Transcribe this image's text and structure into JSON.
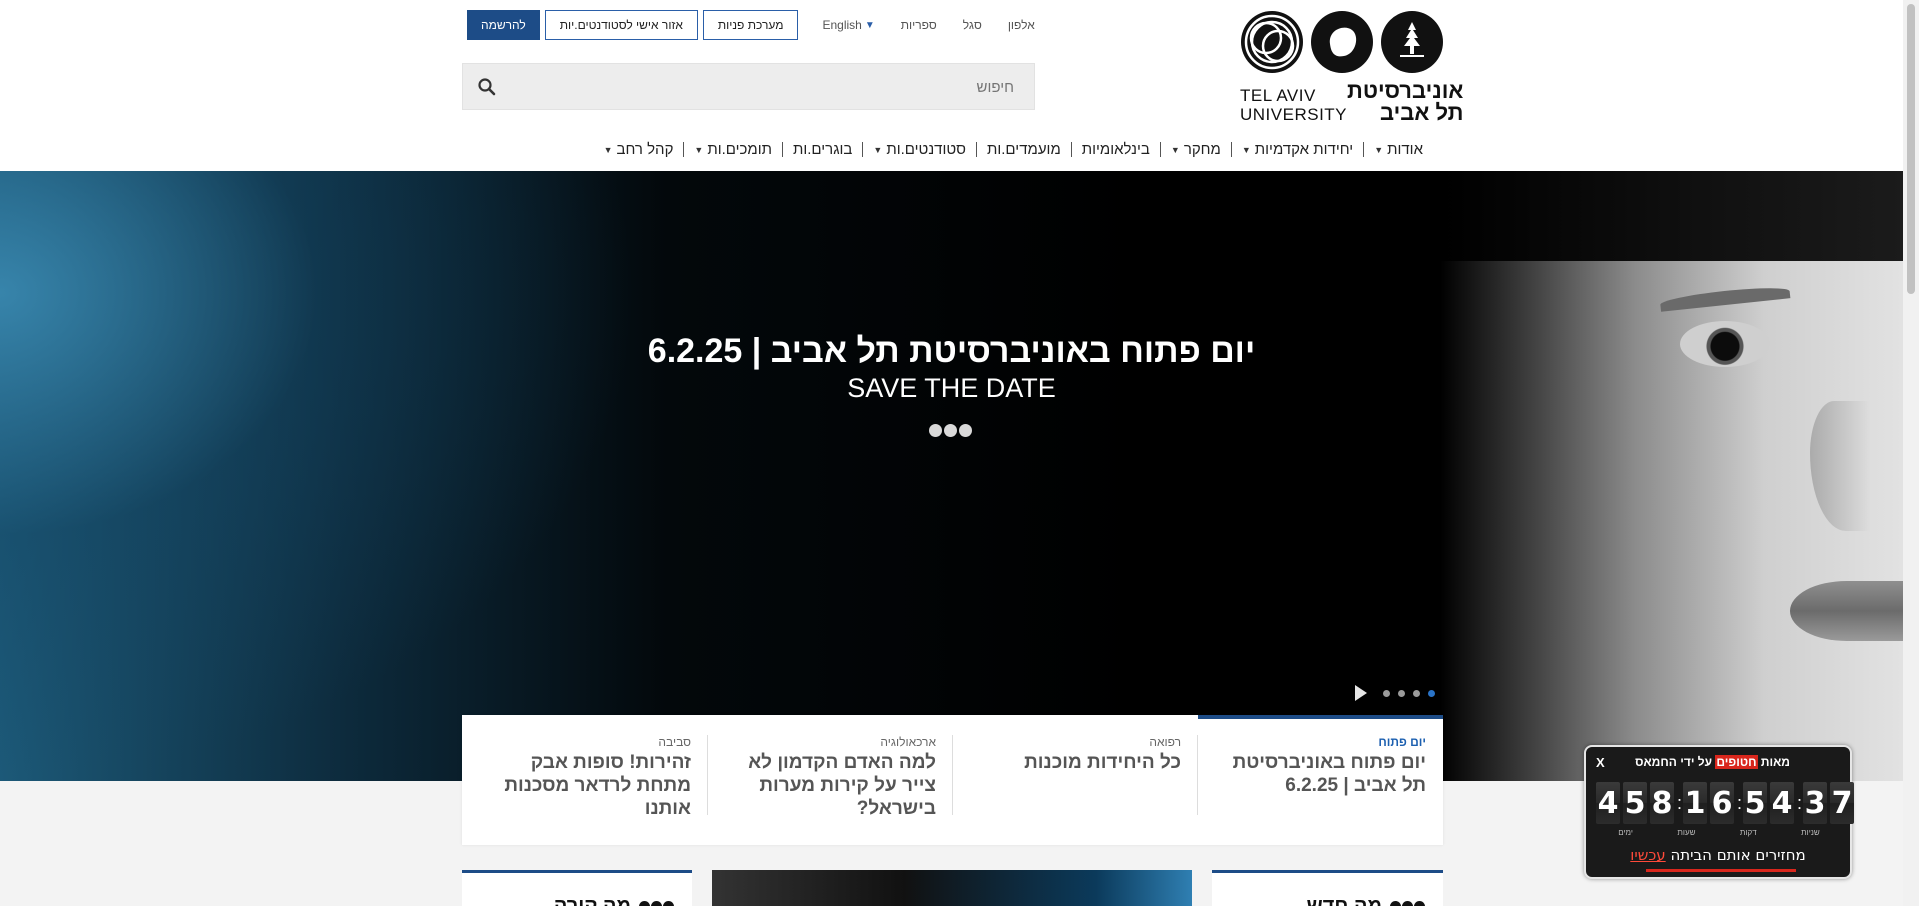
{
  "header": {
    "logo": {
      "en_line1": "TEL AVIV",
      "en_line2": "UNIVERSITY",
      "he_line1": "אוניברסיטת",
      "he_line2": "תל אביב"
    },
    "top_links": [
      "אלפון",
      "סגל",
      "ספריות"
    ],
    "lang": "English",
    "btn_inquiries": "מערכת פניות",
    "btn_students_area": "אזור אישי לסטודנטים.יות",
    "btn_register": "להרשמה",
    "search_placeholder": "חיפוש"
  },
  "nav": [
    {
      "label": "אודות",
      "dropdown": true
    },
    {
      "label": "יחידות אקדמיות",
      "dropdown": true
    },
    {
      "label": "מחקר",
      "dropdown": true
    },
    {
      "label": "בינלאומיות",
      "dropdown": false
    },
    {
      "label": "מועמדים.ות",
      "dropdown": false
    },
    {
      "label": "סטודנטים.ות",
      "dropdown": true
    },
    {
      "label": "בוגרים.ות",
      "dropdown": false
    },
    {
      "label": "תומכים.ות",
      "dropdown": true
    },
    {
      "label": "קהל רחב",
      "dropdown": true
    }
  ],
  "hero": {
    "title": "יום פתוח באוניברסיטת תל אביב | 6.2.25",
    "subtitle": "SAVE THE DATE",
    "slider_count": 4,
    "slider_active": 1
  },
  "tabs": [
    {
      "category": "יום פתוח",
      "title": "יום פתוח באוניברסיטת תל אביב | 6.2.25",
      "active": true
    },
    {
      "category": "רפואה",
      "title": "כל היחידות מוכנות",
      "active": false
    },
    {
      "category": "ארכאולוגיה",
      "title": "למה האדם הקדמון לא צייר על קירות מערות בישראל?",
      "active": false
    },
    {
      "category": "סביבה",
      "title": "זהירות! סופות אבק מתחת לרדאר מסכנות אותנו",
      "active": false
    }
  ],
  "sections": {
    "news": "מה חדש",
    "events": "מה קורה"
  },
  "countdown": {
    "close": "X",
    "head_pre": "מאות ",
    "head_hl": "חטופים",
    "head_post": " על ידי החמאס",
    "days": [
      "4",
      "5",
      "8"
    ],
    "hours": [
      "1",
      "6"
    ],
    "minutes": [
      "5",
      "4"
    ],
    "seconds": [
      "3",
      "7"
    ],
    "labels": {
      "days": "ימים",
      "hours": "שעות",
      "minutes": "דקות",
      "seconds": "שניות"
    },
    "foot_pre": "מחזירים אותם הביתה ",
    "foot_now": "עכשיו"
  },
  "colors": {
    "brand": "#1d4c87",
    "accent_red": "#d9261c"
  }
}
